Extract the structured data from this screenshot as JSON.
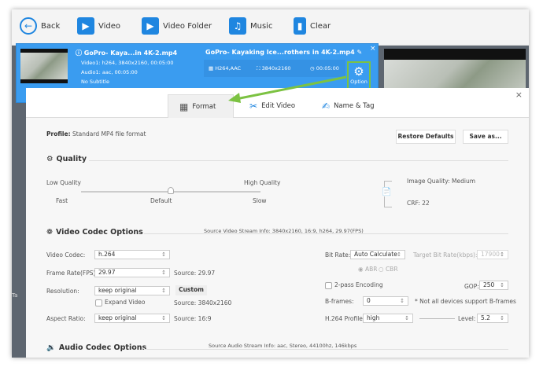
{
  "toolbar": {
    "back": "Back",
    "video": "Video",
    "video_folder": "Video Folder",
    "music": "Music",
    "clear": "Clear"
  },
  "file": {
    "source_name": "GoPro- Kaya...in 4K-2.mp4",
    "video_info": "Video1: h264, 3840x2160, 00:05:00",
    "audio_info": "Audio1: aac, 00:05:00",
    "subtitle": "No Subtitle",
    "output_name": "GoPro- Kayaking Ice...rothers in 4K-2.mp4",
    "output_codec": "H264,AAC",
    "output_resolution": "3840x2160",
    "output_duration": "00:05:00",
    "option_label": "Option",
    "codec_badge": "codec"
  },
  "side_label": "Ta",
  "dialog": {
    "tabs": [
      {
        "label": "Format",
        "active": true
      },
      {
        "label": "Edit Video"
      },
      {
        "label": "Name & Tag"
      }
    ],
    "profile_label": "Profile:",
    "profile_value": "Standard MP4 file format",
    "restore_defaults": "Restore Defaults",
    "save_as": "Save as...",
    "quality": {
      "title": "Quality",
      "low": "Low Quality",
      "high": "High Quality",
      "fast": "Fast",
      "default": "Default",
      "slow": "Slow",
      "slider_position": 0.5,
      "image_quality": "Image Quality: Medium",
      "crf": "CRF: 22"
    },
    "video_codec": {
      "title": "Video Codec Options",
      "source_info": "Source Video Stream Info: 3840x2160, 16:9, h264, 29.97(FPS)",
      "codec_label": "Video Codec:",
      "codec_value": "h.264",
      "fps_label": "Frame Rate(FPS):",
      "fps_value": "29.97",
      "fps_source": "Source: 29.97",
      "res_label": "Resolution:",
      "res_value": "keep original",
      "custom": "Custom",
      "expand": "Expand Video",
      "res_source": "Source: 3840x2160",
      "aspect_label": "Aspect Ratio:",
      "aspect_value": "keep original",
      "aspect_source": "Source: 16:9",
      "bitrate_label": "Bit Rate:",
      "bitrate_value": "Auto Calculate",
      "target_label": "Target Bit Rate(kbps):",
      "target_value": "17900",
      "abr": "ABR",
      "cbr": "CBR",
      "twopass": "2-pass Encoding",
      "gop_label": "GOP:",
      "gop_value": "250",
      "bframes_label": "B-frames:",
      "bframes_value": "0",
      "bframes_note": "* Not all devices support B-frames",
      "profile_label": "H.264 Profile:",
      "profile_value": "high",
      "level_label": "Level:",
      "level_value": "5.2"
    },
    "audio_codec": {
      "title": "Audio Codec Options",
      "source_info": "Source Audio Stream Info: aac, Stereo, 44100hz, 146kbps"
    }
  },
  "colors": {
    "accent": "#1f86e0",
    "card": "#3a9cf0",
    "highlight": "#7cc242"
  }
}
